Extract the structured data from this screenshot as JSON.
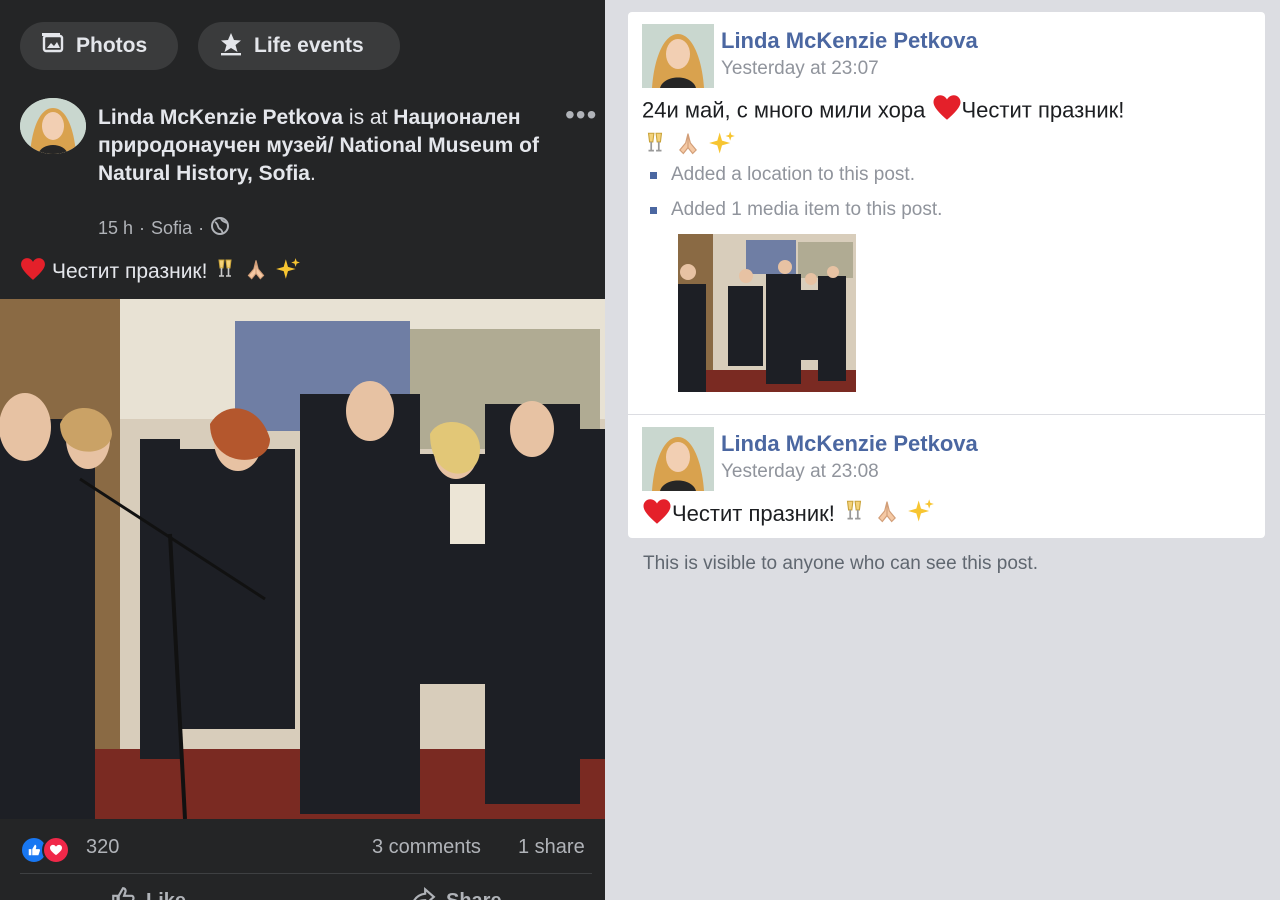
{
  "left": {
    "chips": {
      "photos": "Photos",
      "life_events": "Life events"
    },
    "post": {
      "author": "Linda McKenzie Petkova",
      "is_at": "is at",
      "place": "Национален природонаучен музей/ National Museum of Natural History, Sofia",
      "period": ".",
      "meta_time": "15 h",
      "meta_dot1": "·",
      "meta_location": "Sofia",
      "meta_dot2": "·",
      "more": "•••",
      "caption": "Честит празник!",
      "reaction_count": "320",
      "comments": "3 comments",
      "shares": "1 share",
      "like_label": "Like",
      "share_label": "Share"
    }
  },
  "right": {
    "entries": [
      {
        "name": "Linda McKenzie Petkova",
        "time": "Yesterday at 23:07",
        "text_line1_a": "24и май, с много мили хора",
        "text_line1_b": "Честит празник!",
        "changes": [
          "Added a location to this post.",
          "Added 1 media item to this post."
        ]
      },
      {
        "name": "Linda McKenzie Petkova",
        "time": "Yesterday at 23:08",
        "text": "Честит празник!"
      }
    ],
    "footer": "This is visible to anyone who can see this post."
  },
  "colors": {
    "accent_name": "#4b67a1",
    "dark_bg": "#242526",
    "like": "#1877f2",
    "love": "#f02849"
  }
}
